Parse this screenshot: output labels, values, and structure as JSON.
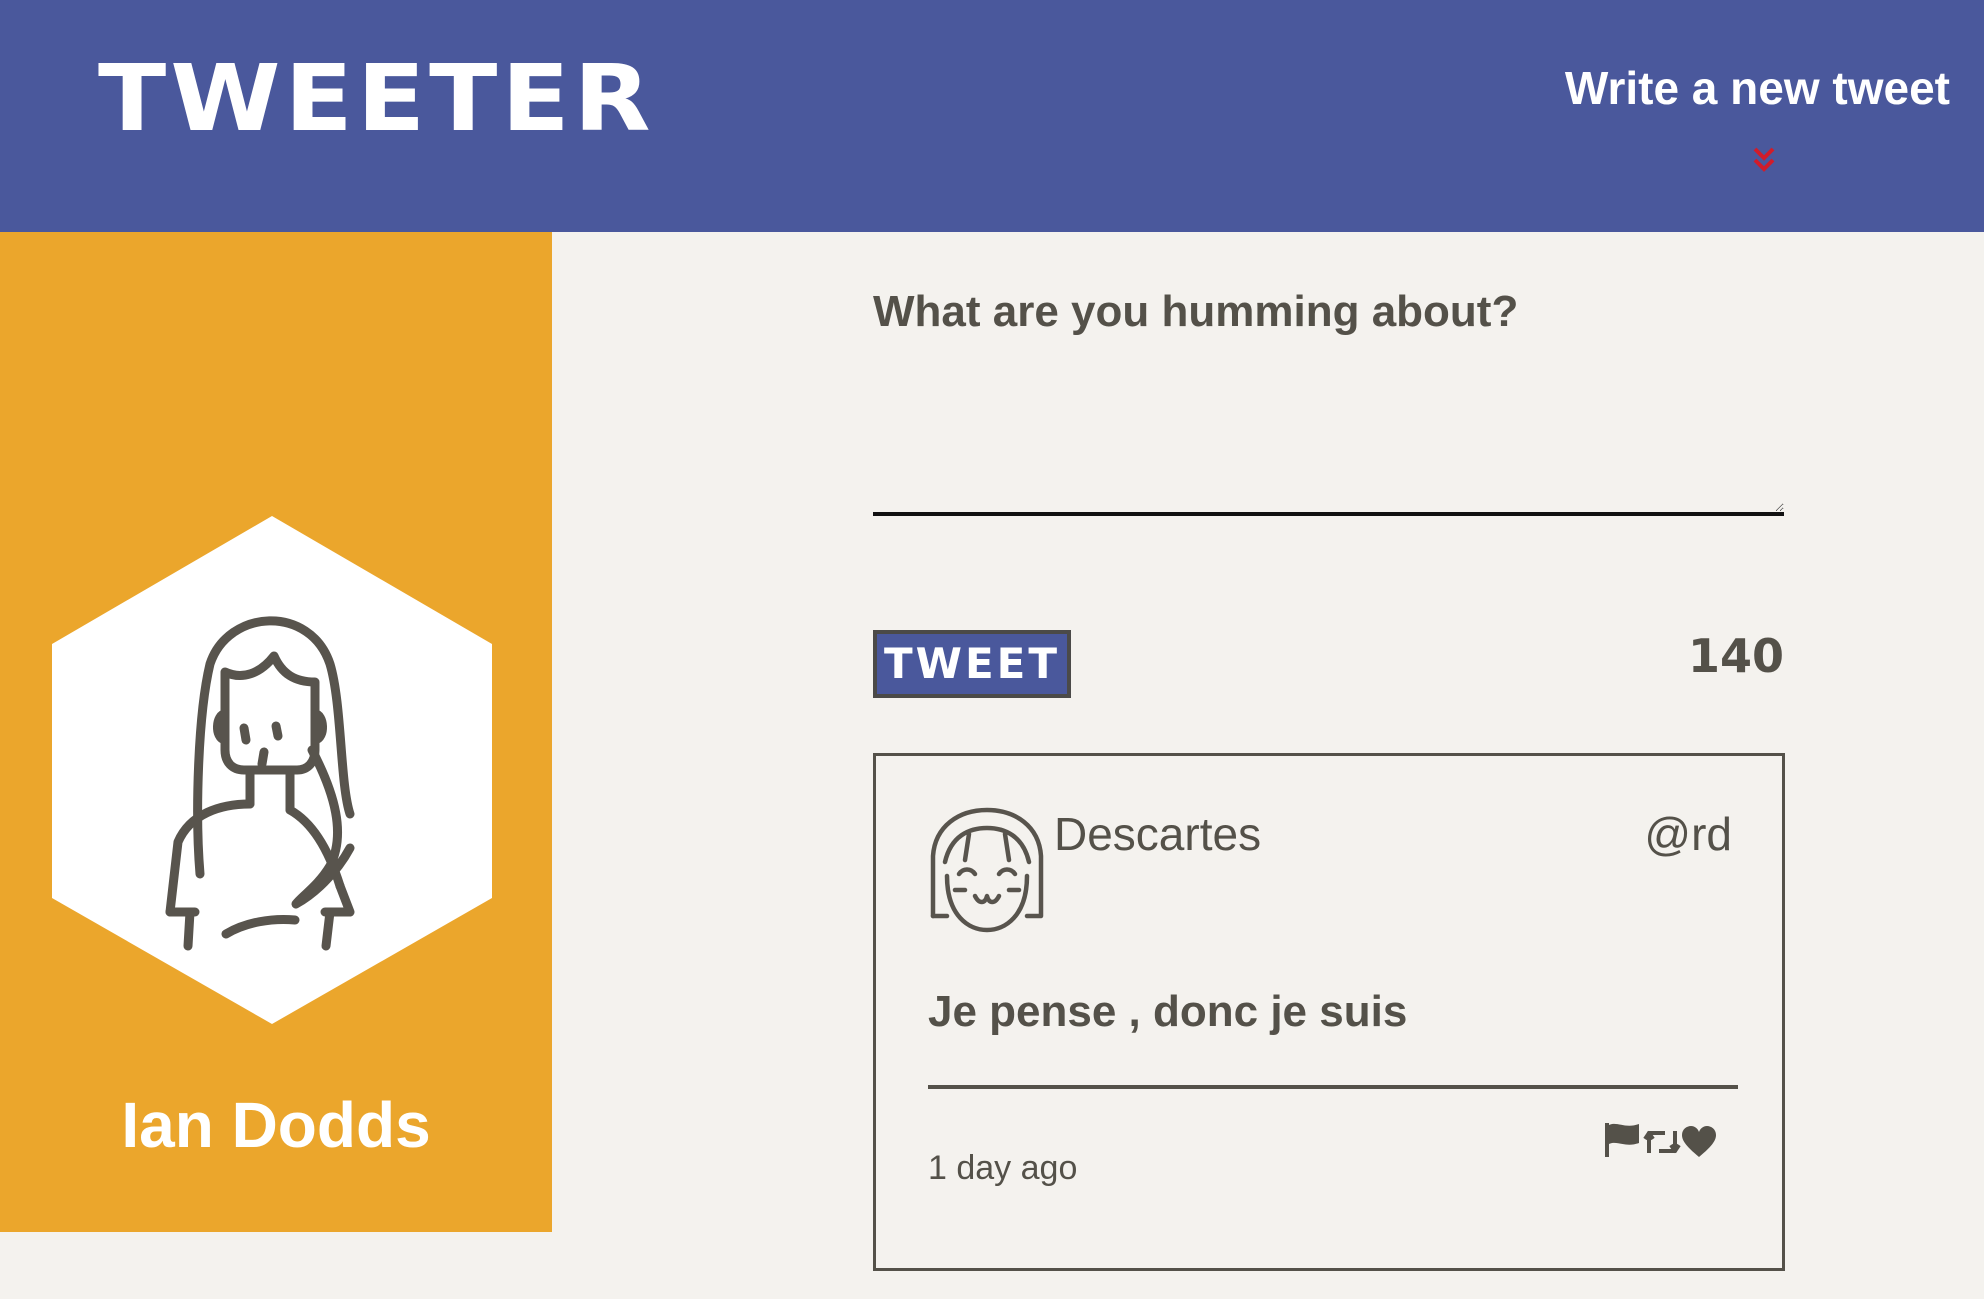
{
  "header": {
    "logo": "TWEETER",
    "compose_toggle": "Write a new tweet",
    "compose_toggle_icon": "double-chevron-down-icon"
  },
  "profile": {
    "name": "Ian Dodds",
    "avatar_icon": "woman-avatar-icon"
  },
  "composer": {
    "prompt": "What are you humming about?",
    "text_value": "",
    "submit_label": "TWEET",
    "char_counter": "140"
  },
  "tweets": [
    {
      "author": "Descartes",
      "handle": "@rd",
      "avatar_icon": "smiling-girl-avatar-icon",
      "content": "Je pense , donc je suis",
      "timestamp": "1 day ago",
      "actions": [
        "flag-icon",
        "retweet-icon",
        "heart-icon"
      ]
    }
  ],
  "colors": {
    "header_bg": "#4a589c",
    "sidebar_bg": "#eba62c",
    "page_bg": "#f4f2ee",
    "text": "#545149",
    "chevron": "#d11c2a"
  }
}
